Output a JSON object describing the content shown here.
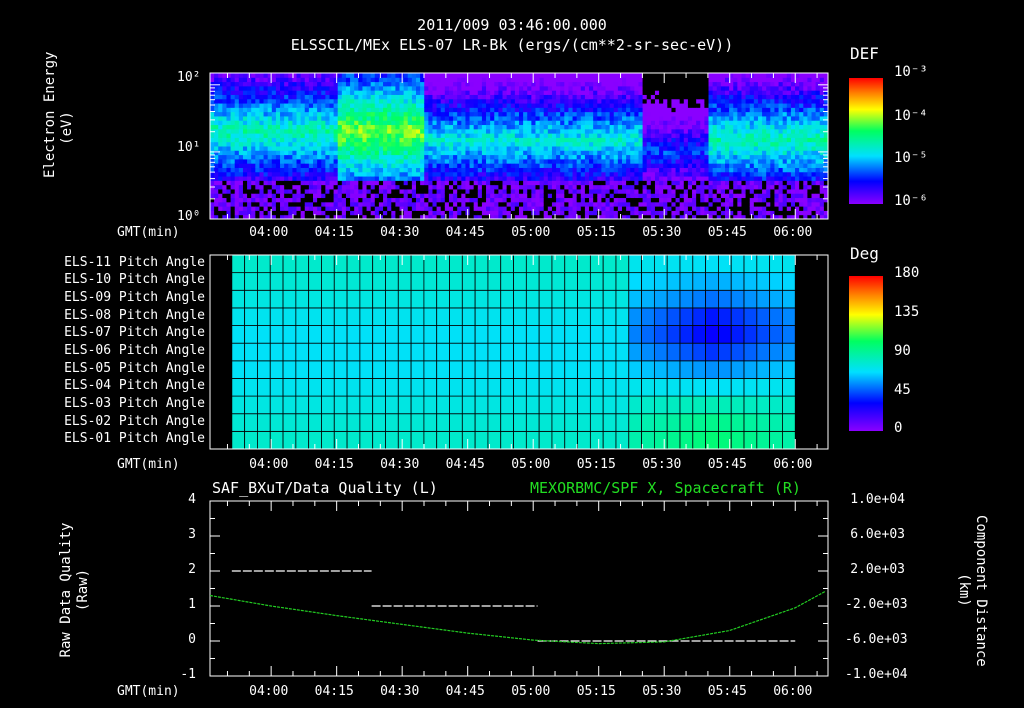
{
  "header": {
    "timestamp": "2011/009 03:46:00.000",
    "title": "ELSSCIL/MEx ELS-07 LR-Bk  (ergs/(cm**2-sr-sec-eV))"
  },
  "xaxis": {
    "label": "GMT(min)",
    "ticks": [
      "04:00",
      "04:15",
      "04:30",
      "04:45",
      "05:00",
      "05:15",
      "05:30",
      "05:45",
      "06:00"
    ]
  },
  "panel1": {
    "ylabel_line1": "Electron Energy",
    "ylabel_line2": "(eV)",
    "yticks": [
      "10²",
      "10¹",
      "10⁰"
    ],
    "colorbar": {
      "title": "DEF",
      "ticks": [
        "10⁻³",
        "10⁻⁴",
        "10⁻⁵",
        "10⁻⁶"
      ]
    }
  },
  "panel2": {
    "row_labels": [
      "ELS-11 Pitch Angle",
      "ELS-10 Pitch Angle",
      "ELS-09 Pitch Angle",
      "ELS-08 Pitch Angle",
      "ELS-07 Pitch Angle",
      "ELS-06 Pitch Angle",
      "ELS-05 Pitch Angle",
      "ELS-04 Pitch Angle",
      "ELS-03 Pitch Angle",
      "ELS-02 Pitch Angle",
      "ELS-01 Pitch Angle"
    ],
    "colorbar": {
      "title": "Deg",
      "ticks": [
        "180",
        "135",
        "90",
        "45",
        "0"
      ]
    }
  },
  "panel3": {
    "left_title": "SAF_BXuT/Data Quality (L)",
    "right_title": "MEXORBMC/SPF X, Spacecraft (R)",
    "ylabel_left_line1": "Raw Data Quality",
    "ylabel_left_line2": "(Raw)",
    "ylabel_right_line1": "Component Distance",
    "ylabel_right_line2": "(km)",
    "yticks_left": [
      "4",
      "3",
      "2",
      "1",
      "0",
      "-1"
    ],
    "yticks_right": [
      "1.0e+04",
      "6.0e+03",
      "2.0e+03",
      "-2.0e+03",
      "-6.0e+03",
      "-1.0e+04"
    ]
  },
  "colors": {
    "background": "#000000",
    "orbit_line": "#22cc22",
    "quality_line": "#ffffff",
    "right_title": "#22dd22"
  },
  "chart_data": [
    {
      "type": "heatmap",
      "title": "ELSSCIL/MEx ELS-07 LR-Bk  (ergs/(cm**2-sr-sec-eV))",
      "xlabel": "GMT(min)",
      "ylabel": "Electron Energy (eV)",
      "y_scale": "log",
      "ylim": [
        1,
        150
      ],
      "colorbar": {
        "label": "DEF",
        "scale": "log",
        "range": [
          1e-06,
          0.001
        ]
      },
      "description_bands": [
        {
          "x_range": [
            "03:46",
            "04:15"
          ],
          "peak_energy_eV": 20,
          "peak_DEF": 3e-05
        },
        {
          "x_range": [
            "04:15",
            "04:35"
          ],
          "peak_energy_eV": 20,
          "peak_DEF": 0.0001
        },
        {
          "x_range": [
            "04:35",
            "05:25"
          ],
          "peak_energy_eV": 15,
          "peak_DEF": 2e-05
        },
        {
          "x_range": [
            "05:25",
            "05:40"
          ],
          "peak_energy_eV": 10,
          "peak_DEF": 5e-06
        },
        {
          "x_range": [
            "05:40",
            "06:07"
          ],
          "peak_energy_eV": 15,
          "peak_DEF": 3e-05
        }
      ]
    },
    {
      "type": "heatmap",
      "xlabel": "GMT(min)",
      "categories": [
        "ELS-01",
        "ELS-02",
        "ELS-03",
        "ELS-04",
        "ELS-05",
        "ELS-06",
        "ELS-07",
        "ELS-08",
        "ELS-09",
        "ELS-10",
        "ELS-11"
      ],
      "x_range": [
        "03:51",
        "06:00"
      ],
      "colorbar": {
        "label": "Deg",
        "range": [
          0,
          180
        ]
      },
      "segments": [
        {
          "x_range": [
            "03:51",
            "05:23"
          ],
          "pitch_angle_deg_by_row": [
            80,
            78,
            75,
            72,
            70,
            70,
            70,
            72,
            75,
            78,
            80
          ]
        },
        {
          "x_range": [
            "05:23",
            "06:00"
          ],
          "pitch_angle_deg_by_row": [
            100,
            95,
            85,
            70,
            55,
            40,
            30,
            35,
            50,
            60,
            70
          ]
        }
      ]
    },
    {
      "type": "line",
      "xlabel": "GMT(min)",
      "series": [
        {
          "name": "SAF_BXuT/Data Quality (L)",
          "axis": "left",
          "ylim": [
            -1,
            4
          ],
          "x": [
            "03:51",
            "04:23",
            "04:23",
            "05:01",
            "05:01",
            "06:00"
          ],
          "y": [
            2,
            2,
            1,
            1,
            0,
            0
          ],
          "step_segments": [
            [
              "03:51",
              "04:23",
              2
            ],
            [
              "04:23",
              "05:01",
              1
            ],
            [
              "05:01",
              "06:00",
              0
            ]
          ]
        },
        {
          "name": "MEXORBMC/SPF X, Spacecraft (R)",
          "axis": "right",
          "ylim": [
            -10000,
            10000
          ],
          "x": [
            "03:46",
            "04:00",
            "04:15",
            "04:30",
            "04:45",
            "05:00",
            "05:15",
            "05:30",
            "05:45",
            "06:00",
            "06:07"
          ],
          "y": [
            -800,
            -2000,
            -3100,
            -4100,
            -5100,
            -5900,
            -6300,
            -6100,
            -4800,
            -2200,
            -300
          ]
        }
      ]
    }
  ]
}
